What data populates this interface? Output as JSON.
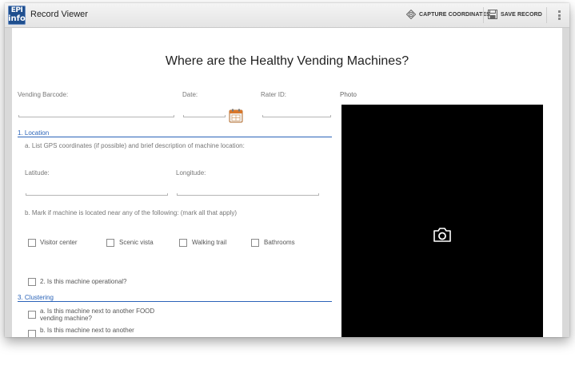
{
  "actionbar": {
    "title": "Record Viewer",
    "logo_line1": "EPI",
    "logo_line2": "info",
    "capture_label": "CAPTURE COORDINATES",
    "save_label": "SAVE RECORD"
  },
  "form": {
    "title": "Where are the Healthy Vending Machines?",
    "fields": {
      "vending_barcode": {
        "label": "Vending Barcode:",
        "value": ""
      },
      "date": {
        "label": "Date:",
        "value": ""
      },
      "rater_id": {
        "label": "Rater ID:",
        "value": ""
      },
      "photo": {
        "label": "Photo"
      },
      "latitude": {
        "label": "Latitude:",
        "value": ""
      },
      "longitude": {
        "label": "Longitude:",
        "value": ""
      }
    },
    "section1": {
      "heading": "1. Location",
      "question_a": "a. List GPS coordinates (if possible) and brief description of machine location:",
      "question_b": "b. Mark if machine is located near any of the following: (mark all that apply)",
      "options": [
        {
          "label": "Visitor center",
          "checked": false
        },
        {
          "label": "Scenic vista",
          "checked": false
        },
        {
          "label": "Walking trail",
          "checked": false
        },
        {
          "label": "Bathrooms",
          "checked": false
        }
      ]
    },
    "operational": {
      "label": "2. Is this machine operational?",
      "checked": false
    },
    "section3": {
      "heading": "3. Clustering",
      "items": [
        {
          "line1": "a. Is this machine next to another FOOD",
          "line2": "vending machine?",
          "checked": false
        },
        {
          "line1": "b. Is this machine next to another",
          "line2": "",
          "checked": false
        }
      ]
    }
  },
  "colors": {
    "section_accent": "#2a63b8",
    "actionbar_bg": "#ececec",
    "photo_bg": "#000000",
    "logo_bg": "#1f4f8e"
  },
  "icons": {
    "capture": "crosshair-target-icon",
    "save": "floppy-disk-icon",
    "overflow": "overflow-menu-icon",
    "calendar": "calendar-icon",
    "camera": "camera-icon"
  }
}
